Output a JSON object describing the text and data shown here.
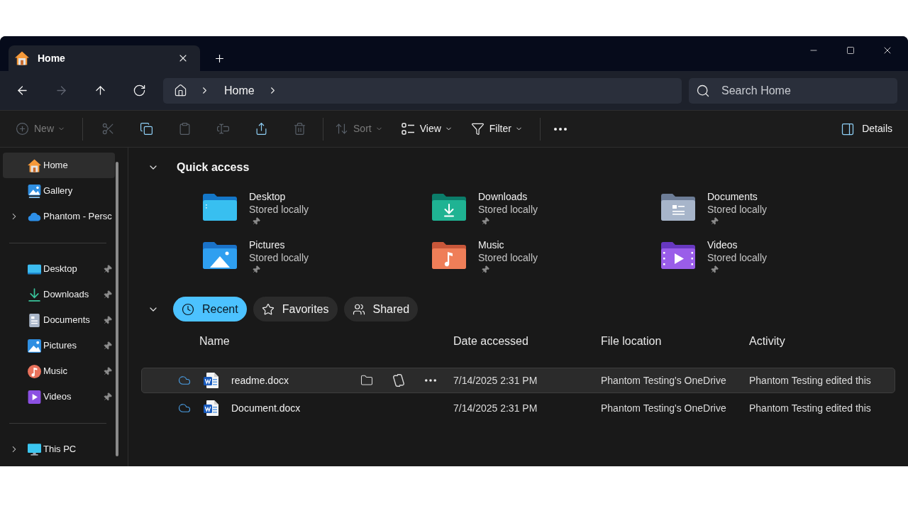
{
  "window": {
    "tabs": [
      {
        "label": "Home",
        "kind": "home",
        "selected": true
      }
    ]
  },
  "navigation": {
    "buttons": [
      {
        "kind": "back",
        "disabled": false
      },
      {
        "kind": "forward",
        "disabled": true
      },
      {
        "kind": "up",
        "disabled": false
      },
      {
        "kind": "refresh",
        "disabled": false
      }
    ],
    "breadcrumb": [
      {
        "label": "Home"
      }
    ],
    "search": {
      "placeholder": "Search Home"
    }
  },
  "toolbar": {
    "items": [
      {
        "kind": "new",
        "label": "New",
        "dropdown": true,
        "disabled": true
      },
      {
        "kind": "separator"
      },
      {
        "kind": "cut",
        "disabled": true
      },
      {
        "kind": "copy",
        "disabled": false
      },
      {
        "kind": "paste",
        "disabled": true
      },
      {
        "kind": "rename",
        "disabled": true
      },
      {
        "kind": "share",
        "disabled": false
      },
      {
        "kind": "delete",
        "disabled": true
      },
      {
        "kind": "separator"
      },
      {
        "kind": "sort",
        "label": "Sort",
        "dropdown": true,
        "disabled": true
      },
      {
        "kind": "view",
        "label": "View",
        "dropdown": true,
        "disabled": false
      },
      {
        "kind": "filter",
        "label": "Filter",
        "dropdown": true,
        "disabled": false
      },
      {
        "kind": "separator"
      },
      {
        "kind": "more",
        "disabled": false
      }
    ],
    "details": {
      "label": "Details"
    }
  },
  "sidebar": {
    "sections": [
      {
        "items": [
          {
            "label": "Home",
            "kind": "home",
            "selected": true,
            "expandable": false,
            "pinned": false
          },
          {
            "label": "Gallery",
            "kind": "gallery",
            "selected": false,
            "expandable": false,
            "pinned": false
          },
          {
            "label": "Phantom - Persc",
            "kind": "onedrive",
            "selected": false,
            "expandable": true,
            "expanded": false,
            "pinned": false
          }
        ]
      },
      {
        "items": [
          {
            "label": "Desktop",
            "kind": "desktop",
            "selected": false,
            "expandable": false,
            "pinned": true
          },
          {
            "label": "Downloads",
            "kind": "downloads",
            "selected": false,
            "expandable": false,
            "pinned": true
          },
          {
            "label": "Documents",
            "kind": "documents",
            "selected": false,
            "expandable": false,
            "pinned": true
          },
          {
            "label": "Pictures",
            "kind": "pictures",
            "selected": false,
            "expandable": false,
            "pinned": true
          },
          {
            "label": "Music",
            "kind": "music",
            "selected": false,
            "expandable": false,
            "pinned": true
          },
          {
            "label": "Videos",
            "kind": "videos",
            "selected": false,
            "expandable": false,
            "pinned": true
          }
        ]
      },
      {
        "items": [
          {
            "label": "This PC",
            "kind": "pc",
            "selected": false,
            "expandable": true,
            "expanded": false,
            "pinned": false
          }
        ]
      }
    ]
  },
  "quick_access": {
    "title": "Quick access",
    "expanded": true,
    "items": [
      {
        "name": "Desktop",
        "status": "Stored locally",
        "kind": "desktop",
        "pinned": true
      },
      {
        "name": "Downloads",
        "status": "Stored locally",
        "kind": "downloads",
        "pinned": true
      },
      {
        "name": "Documents",
        "status": "Stored locally",
        "kind": "documents",
        "pinned": true
      },
      {
        "name": "Pictures",
        "status": "Stored locally",
        "kind": "pictures",
        "pinned": true
      },
      {
        "name": "Music",
        "status": "Stored locally",
        "kind": "music",
        "pinned": true
      },
      {
        "name": "Videos",
        "status": "Stored locally",
        "kind": "videos",
        "pinned": true
      }
    ]
  },
  "recent": {
    "expanded": true,
    "tabs": [
      {
        "label": "Recent",
        "kind": "recent",
        "selected": true
      },
      {
        "label": "Favorites",
        "kind": "favorites",
        "selected": false
      },
      {
        "label": "Shared",
        "kind": "shared",
        "selected": false
      }
    ],
    "columns": [
      "Name",
      "Date accessed",
      "File location",
      "Activity"
    ],
    "rows": [
      {
        "name": "readme.docx",
        "cloud_only": true,
        "date_accessed": "7/14/2025 2:31 PM",
        "file_location": "Phantom Testing's OneDrive",
        "activity": "Phantom Testing edited this",
        "hovered": true
      },
      {
        "name": "Document.docx",
        "cloud_only": true,
        "date_accessed": "7/14/2025 2:31 PM",
        "file_location": "Phantom Testing's OneDrive",
        "activity": "Phantom Testing edited this",
        "hovered": false
      }
    ]
  }
}
